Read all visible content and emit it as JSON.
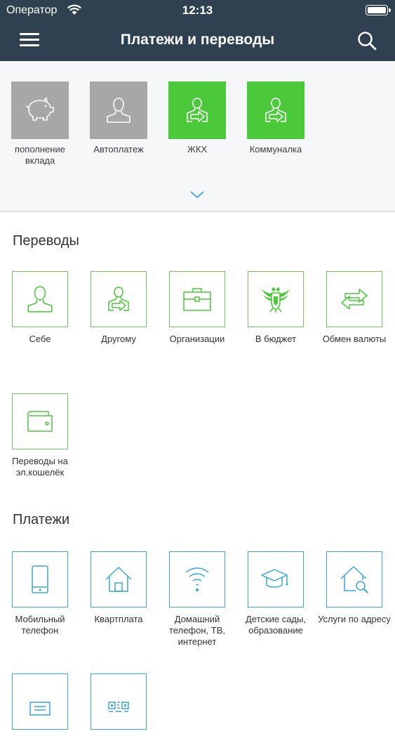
{
  "status_bar": {
    "carrier": "Оператор",
    "time": "12:13"
  },
  "nav": {
    "title": "Платежи и переводы"
  },
  "favorites": [
    {
      "label": "пополнение вклада",
      "icon": "piggy-bank-icon",
      "color": "#a7a7a7"
    },
    {
      "label": "Автоплатеж",
      "icon": "person-icon",
      "color": "#a7a7a7"
    },
    {
      "label": "ЖКХ",
      "icon": "person-transfer-icon",
      "color": "#4cc93b"
    },
    {
      "label": "Коммуналка",
      "icon": "person-transfer-icon",
      "color": "#4cc93b"
    }
  ],
  "transfers": {
    "title": "Переводы",
    "items": [
      {
        "label": "Себе",
        "icon": "person-icon"
      },
      {
        "label": "Другому",
        "icon": "person-transfer-icon"
      },
      {
        "label": "Организации",
        "icon": "briefcase-icon"
      },
      {
        "label": "В бюджет",
        "icon": "eagle-emblem-icon"
      },
      {
        "label": "Обмен валюты",
        "icon": "exchange-arrows-icon"
      },
      {
        "label": "Переводы на эл.кошелёк",
        "icon": "wallet-icon"
      }
    ]
  },
  "payments": {
    "title": "Платежи",
    "items": [
      {
        "label": "Мобильный телефон",
        "icon": "mobile-phone-icon"
      },
      {
        "label": "Квартплата",
        "icon": "house-icon"
      },
      {
        "label": "Домашний телефон, ТВ, интернет",
        "icon": "wifi-icon"
      },
      {
        "label": "Детские сады, образование",
        "icon": "graduation-cap-icon"
      },
      {
        "label": "Услуги по адресу",
        "icon": "house-search-icon"
      },
      {
        "label": "",
        "icon": "document-icon"
      },
      {
        "label": "",
        "icon": "qr-code-icon"
      }
    ]
  },
  "colors": {
    "header": "#2f4150",
    "green": "#4cc93b",
    "green_outline": "#6dcb5c",
    "blue_outline": "#36a9d9",
    "grey_tile": "#a7a7a7"
  }
}
